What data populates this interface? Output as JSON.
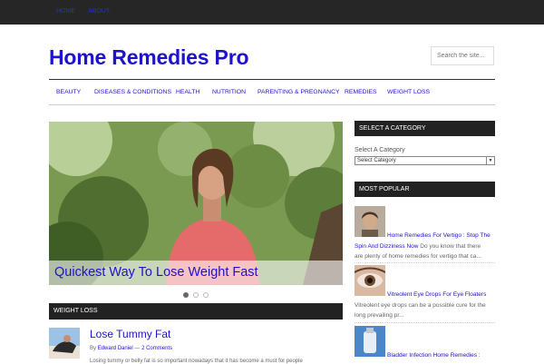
{
  "topbar": {
    "links": [
      "Home",
      "About"
    ]
  },
  "header": {
    "site_title": "Home Remedies Pro",
    "search_placeholder": "Search the site..."
  },
  "nav": {
    "items": [
      "Beauty",
      "Diseases & Conditions",
      "Health",
      "Nutrition",
      "Parenting & Pregnancy",
      "Remedies",
      "Weight Loss"
    ]
  },
  "slider": {
    "caption": "Quickest Way To Lose Weight Fast",
    "slide_count": 3,
    "active_slide": 1
  },
  "section": {
    "title": "Weight Loss"
  },
  "post": {
    "title": "Lose Tummy Fat",
    "by": "By",
    "author": "Edward Daniel",
    "separator": "—",
    "comments": "2 Comments",
    "excerpt": "Losing tummy or belly fat is so important nowadays that it has become a must for people"
  },
  "sidebar": {
    "category_widget_title": "Select A Category",
    "category_label": "Select A Category",
    "category_selected": "Select Category",
    "popular_widget_title": "Most Popular",
    "popular": [
      {
        "title_line1": "Home Remedies For Vertigo : Stop The",
        "title_line2": "Spin And Dizziness Now",
        "excerpt_line2": "Do you know that there",
        "excerpt_line3": "are plenty of home remedies for vertigo that ca..."
      },
      {
        "title_line1": "Vitreolent Eye Drops For Eye Floaters",
        "excerpt_line2": "Vitreolent eye drops can be a possible cure for the",
        "excerpt_line3": "long prevailing pr..."
      },
      {
        "title_line1": "Bladder Infection Home Remedies :"
      }
    ]
  },
  "colors": {
    "link": "#1e12cc",
    "dark_bar": "#222222",
    "topbar": "#262626"
  }
}
